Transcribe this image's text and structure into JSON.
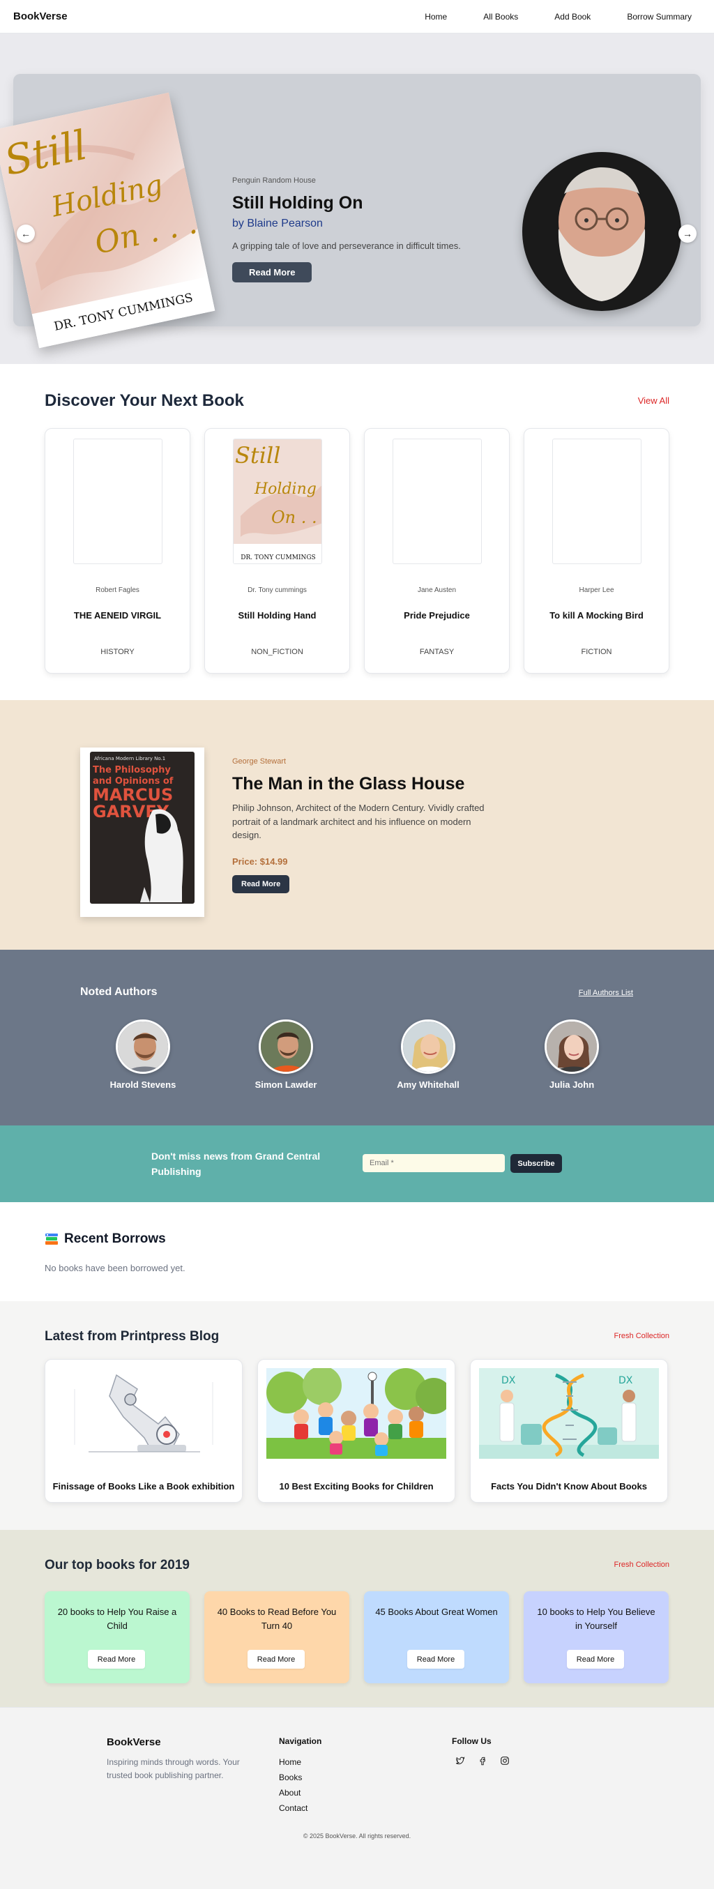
{
  "nav": {
    "brand": "BookVerse",
    "links": [
      "Home",
      "All Books",
      "Add Book",
      "Borrow Summary"
    ]
  },
  "hero": {
    "publisher": "Penguin Random House",
    "title": "Still Holding On",
    "author": "by Blaine Pearson",
    "description": "A gripping tale of love and perseverance in difficult times.",
    "button": "Read More",
    "cover": {
      "title_lines": [
        "Still",
        "Holding",
        "On . . ."
      ],
      "author": "DR. TONY CUMMINGS"
    }
  },
  "discover": {
    "title": "Discover Your Next Book",
    "view_all": "View All",
    "books": [
      {
        "author": "Robert Fagles",
        "title": "THE AENEID VIRGIL",
        "genre": "HISTORY",
        "has_cover": false
      },
      {
        "author": "Dr. Tony cummings",
        "title": "Still Holding Hand",
        "genre": "NON_FICTION",
        "has_cover": true
      },
      {
        "author": "Jane Austen",
        "title": "Pride Prejudice",
        "genre": "FANTASY",
        "has_cover": false
      },
      {
        "author": "Harper Lee",
        "title": "To kill A Mocking Bird",
        "genre": "FICTION",
        "has_cover": false
      }
    ]
  },
  "featured": {
    "author": "George Stewart",
    "title": "The Man in the Glass House",
    "description": "Philip Johnson, Architect of the Modern Century. Vividly crafted portrait of a landmark architect and his influence on modern design.",
    "price": "Price: $14.99",
    "button": "Read More",
    "cover": {
      "series": "Africana Modern Library No.1",
      "title_lines": [
        "The Philosophy",
        "and Opinions of"
      ],
      "name_lines": [
        "MARCUS",
        "GARVEY"
      ]
    }
  },
  "authors": {
    "title": "Noted Authors",
    "full_list": "Full Authors List",
    "people": [
      {
        "name": "Harold Stevens"
      },
      {
        "name": "Simon Lawder"
      },
      {
        "name": "Amy Whitehall"
      },
      {
        "name": "Julia John"
      }
    ]
  },
  "newsletter": {
    "text": "Don't miss news from Grand Central Publishing",
    "placeholder": "Email *",
    "button": "Subscribe"
  },
  "recent": {
    "title": "Recent Borrows",
    "empty": "No books have been borrowed yet."
  },
  "blog": {
    "title": "Latest from Printpress Blog",
    "link": "Fresh Collection",
    "posts": [
      {
        "title": "Finissage of Books Like a Book exhibition"
      },
      {
        "title": "10 Best Exciting Books for Children"
      },
      {
        "title": "Facts You Didn't Know About Books"
      }
    ]
  },
  "top": {
    "title": "Our top books for 2019",
    "link": "Fresh Collection",
    "cards": [
      {
        "title": "20 books to Help You Raise a Child",
        "button": "Read More",
        "color": "#bbf7d0"
      },
      {
        "title": "40 Books to Read Before You Turn 40",
        "button": "Read More",
        "color": "#fed7aa"
      },
      {
        "title": "45 Books About Great Women",
        "button": "Read More",
        "color": "#bfdbfe"
      },
      {
        "title": "10 books to Help You Believe in Yourself",
        "button": "Read More",
        "color": "#c7d2fe"
      }
    ]
  },
  "footer": {
    "brand": "BookVerse",
    "tagline": "Inspiring minds through words. Your trusted book publishing partner.",
    "nav_heading": "Navigation",
    "nav_links": [
      "Home",
      "Books",
      "About",
      "Contact"
    ],
    "follow_heading": "Follow Us",
    "social": [
      "twitter-icon",
      "facebook-icon",
      "instagram-icon"
    ],
    "copyright": "© 2025 BookVerse. All rights reserved."
  }
}
